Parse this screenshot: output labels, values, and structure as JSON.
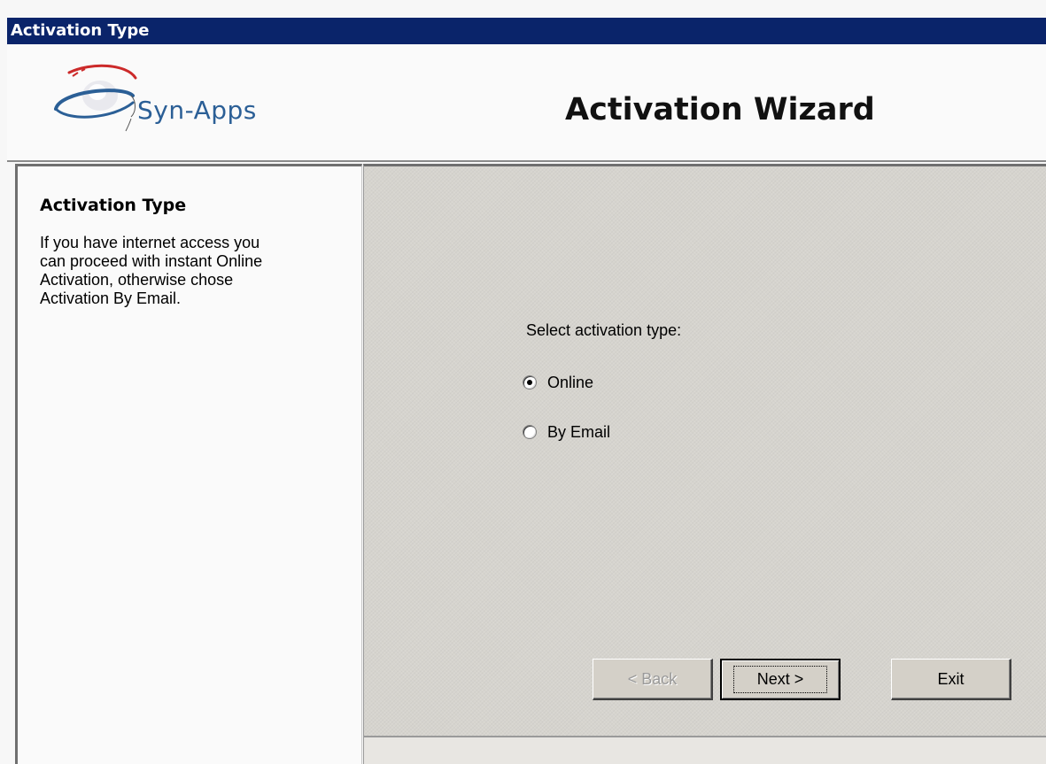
{
  "window": {
    "title": "Activation Type"
  },
  "header": {
    "logo_text": "Syn-Apps",
    "wizard_title": "Activation Wizard"
  },
  "sidebar": {
    "heading": "Activation Type",
    "description": "If you have internet access you\ncan proceed with instant Online\nActivation, otherwise chose\nActivation By Email."
  },
  "main": {
    "select_label": "Select activation type:",
    "options": [
      {
        "label": "Online",
        "checked": true
      },
      {
        "label": "By Email",
        "checked": false
      }
    ]
  },
  "buttons": {
    "back_label": "< Back",
    "back_enabled": false,
    "next_label": "Next >",
    "exit_label": "Exit"
  },
  "colors": {
    "titlebar": "#0a246a",
    "panel": "#d6d4ce",
    "logo_blue": "#2b5f96",
    "logo_red": "#cc2a2a"
  }
}
